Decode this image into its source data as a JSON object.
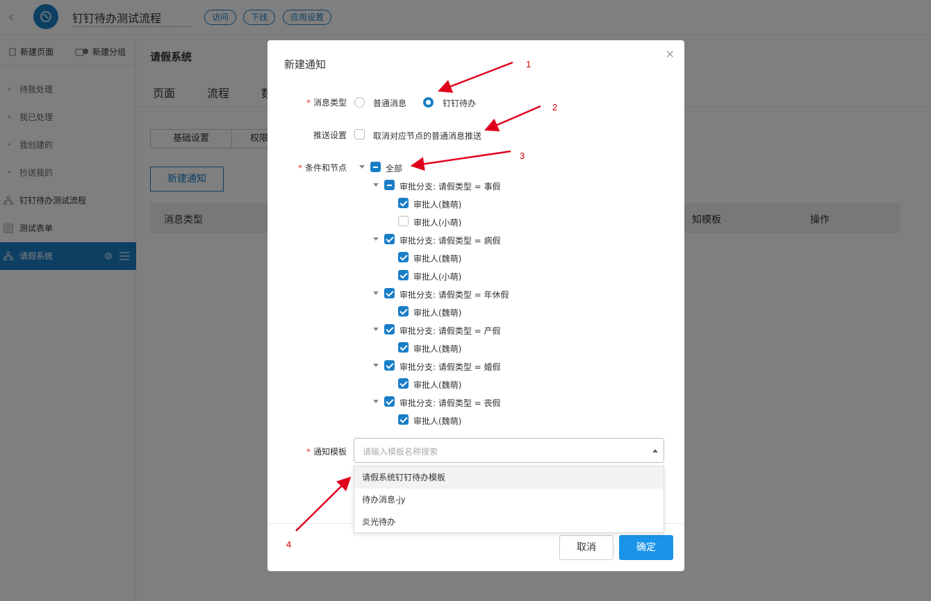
{
  "app": {
    "title": "钉钉待办测试流程",
    "actions": [
      "访问",
      "下线",
      "应用设置"
    ]
  },
  "sidebar": {
    "new_page": "新建页面",
    "new_group": "新建分组",
    "items": [
      {
        "label": "待我处理"
      },
      {
        "label": "我已处理"
      },
      {
        "label": "我创建的"
      },
      {
        "label": "抄送我的"
      },
      {
        "label": "钉钉待办测试流程"
      },
      {
        "label": "测试表单"
      },
      {
        "label": "请假系统"
      }
    ]
  },
  "main": {
    "title": "请假系统",
    "tabs": [
      "页面",
      "流程",
      "数"
    ],
    "segments": [
      "基础设置",
      "权限"
    ],
    "new_notice_button": "新建通知",
    "table_headers": [
      "消息类型",
      "知模板",
      "操作"
    ]
  },
  "modal": {
    "title": "新建通知",
    "close": "×",
    "message_type": {
      "label": "消息类型",
      "options": [
        "普通消息",
        "钉钉待办"
      ],
      "selected": "钉钉待办"
    },
    "push_settings": {
      "label": "推送设置",
      "checkbox_label": "取消对应节点的普通消息推送",
      "checked": false
    },
    "conditions": {
      "label": "条件和节点",
      "root": "全部",
      "branches": [
        {
          "label": "审批分支: 请假类型 = 事假",
          "state": "indeterminate",
          "children": [
            {
              "label": "审批人(魏萌)",
              "checked": true
            },
            {
              "label": "审批人(小萌)",
              "checked": false
            }
          ]
        },
        {
          "label": "审批分支: 请假类型 = 病假",
          "state": "checked",
          "children": [
            {
              "label": "审批人(魏萌)",
              "checked": true
            },
            {
              "label": "审批人(小萌)",
              "checked": true
            }
          ]
        },
        {
          "label": "审批分支: 请假类型 = 年休假",
          "state": "checked",
          "children": [
            {
              "label": "审批人(魏萌)",
              "checked": true
            }
          ]
        },
        {
          "label": "审批分支: 请假类型 = 产假",
          "state": "checked",
          "children": [
            {
              "label": "审批人(魏萌)",
              "checked": true
            }
          ]
        },
        {
          "label": "审批分支: 请假类型 = 婚假",
          "state": "checked",
          "children": [
            {
              "label": "审批人(魏萌)",
              "checked": true
            }
          ]
        },
        {
          "label": "审批分支: 请假类型 = 丧假",
          "state": "checked",
          "children": [
            {
              "label": "审批人(魏萌)",
              "checked": true
            }
          ]
        }
      ]
    },
    "template": {
      "label": "通知模板",
      "placeholder": "请输入模板名称搜索",
      "options": [
        "请假系统钉钉待办模板",
        "待办消息-jy",
        "炎光待办"
      ]
    },
    "cancel": "取消",
    "confirm": "确定"
  },
  "annotations": [
    "1",
    "2",
    "3",
    "4"
  ],
  "colors": {
    "primary": "#1a7ec7",
    "confirm": "#1a94e8",
    "annotation": "#e0001b"
  }
}
